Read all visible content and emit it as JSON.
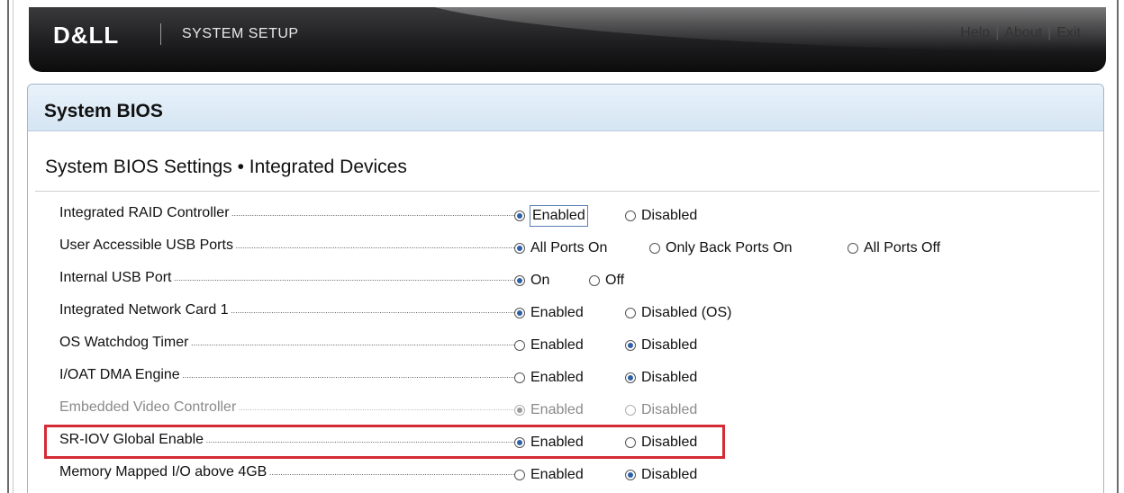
{
  "header": {
    "logo": "D&LL",
    "app_title": "SYSTEM SETUP",
    "links": [
      "Help",
      "About",
      "Exit"
    ],
    "separator": "|"
  },
  "panel": {
    "title": "System BIOS"
  },
  "section": {
    "title": "System BIOS Settings • Integrated Devices"
  },
  "settings": [
    {
      "label": "Integrated RAID Controller",
      "options": [
        "Enabled",
        "Disabled"
      ],
      "selected": 0,
      "disabled": false
    },
    {
      "label": "User Accessible USB Ports",
      "options": [
        "All Ports On",
        "Only Back Ports On",
        "All Ports Off"
      ],
      "selected": 0,
      "disabled": false
    },
    {
      "label": "Internal USB Port",
      "options": [
        "On",
        "Off"
      ],
      "selected": 0,
      "disabled": false
    },
    {
      "label": "Integrated Network Card 1",
      "options": [
        "Enabled",
        "Disabled (OS)"
      ],
      "selected": 0,
      "disabled": false
    },
    {
      "label": "OS Watchdog Timer",
      "options": [
        "Enabled",
        "Disabled"
      ],
      "selected": 1,
      "disabled": false
    },
    {
      "label": "I/OAT DMA Engine",
      "options": [
        "Enabled",
        "Disabled"
      ],
      "selected": 1,
      "disabled": false
    },
    {
      "label": "Embedded Video Controller",
      "options": [
        "Enabled",
        "Disabled"
      ],
      "selected": 0,
      "disabled": true
    },
    {
      "label": "SR-IOV Global Enable",
      "options": [
        "Enabled",
        "Disabled"
      ],
      "selected": 0,
      "disabled": false,
      "highlighted": true
    },
    {
      "label": "Memory Mapped I/O above 4GB",
      "options": [
        "Enabled",
        "Disabled"
      ],
      "selected": 1,
      "disabled": false
    }
  ],
  "colors": {
    "radio_selected": "#2d5fa8",
    "highlight_border": "#d52b34",
    "title_bar": "#d5e5f3"
  }
}
